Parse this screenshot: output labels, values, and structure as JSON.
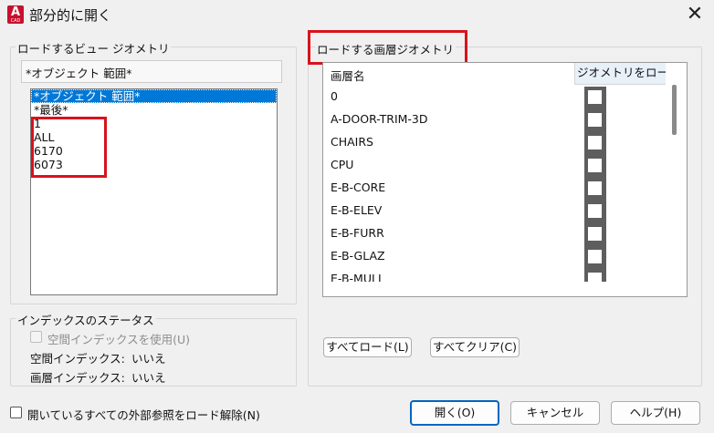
{
  "window": {
    "title": "部分的に開く",
    "app_icon_letter": "A",
    "app_icon_sub": "CAD",
    "close_glyph": "✕"
  },
  "left_group": {
    "legend": "ロードするビュー ジオメトリ",
    "combo_value": "*オブジェクト 範囲*",
    "list_items": [
      "*オブジェクト 範囲*",
      "*最後*",
      "1",
      "ALL",
      "6170",
      "6073"
    ],
    "selected_index": 0
  },
  "index_status": {
    "legend": "インデックスのステータス",
    "use_spatial_label": "空間インデックスを使用(U)",
    "spatial_label": "空間インデックス:",
    "spatial_value": "いいえ",
    "layer_label": "画層インデックス:",
    "layer_value": "いいえ"
  },
  "right_group": {
    "legend": "ロードする画層ジオメトリ",
    "col_layer_name": "画層名",
    "col_load": "ジオメトリをロード",
    "layers": [
      "0",
      "A-DOOR-TRIM-3D",
      "CHAIRS",
      "CPU",
      "E-B-CORE",
      "E-B-ELEV",
      "E-B-FURR",
      "E-B-GLAZ",
      "E-B-MULL"
    ],
    "load_all_button": "すべてロード(L)",
    "clear_all_button": "すべてクリア(C)"
  },
  "bottom": {
    "unload_xrefs_label": "開いているすべての外部参照をロード解除(N)",
    "open_button": "開く(O)",
    "cancel_button": "キャンセル",
    "help_button": "ヘルプ(H)"
  },
  "colors": {
    "highlight_red": "#d9121d",
    "selection_blue": "#0078d7",
    "default_button_border": "#0067c0"
  }
}
